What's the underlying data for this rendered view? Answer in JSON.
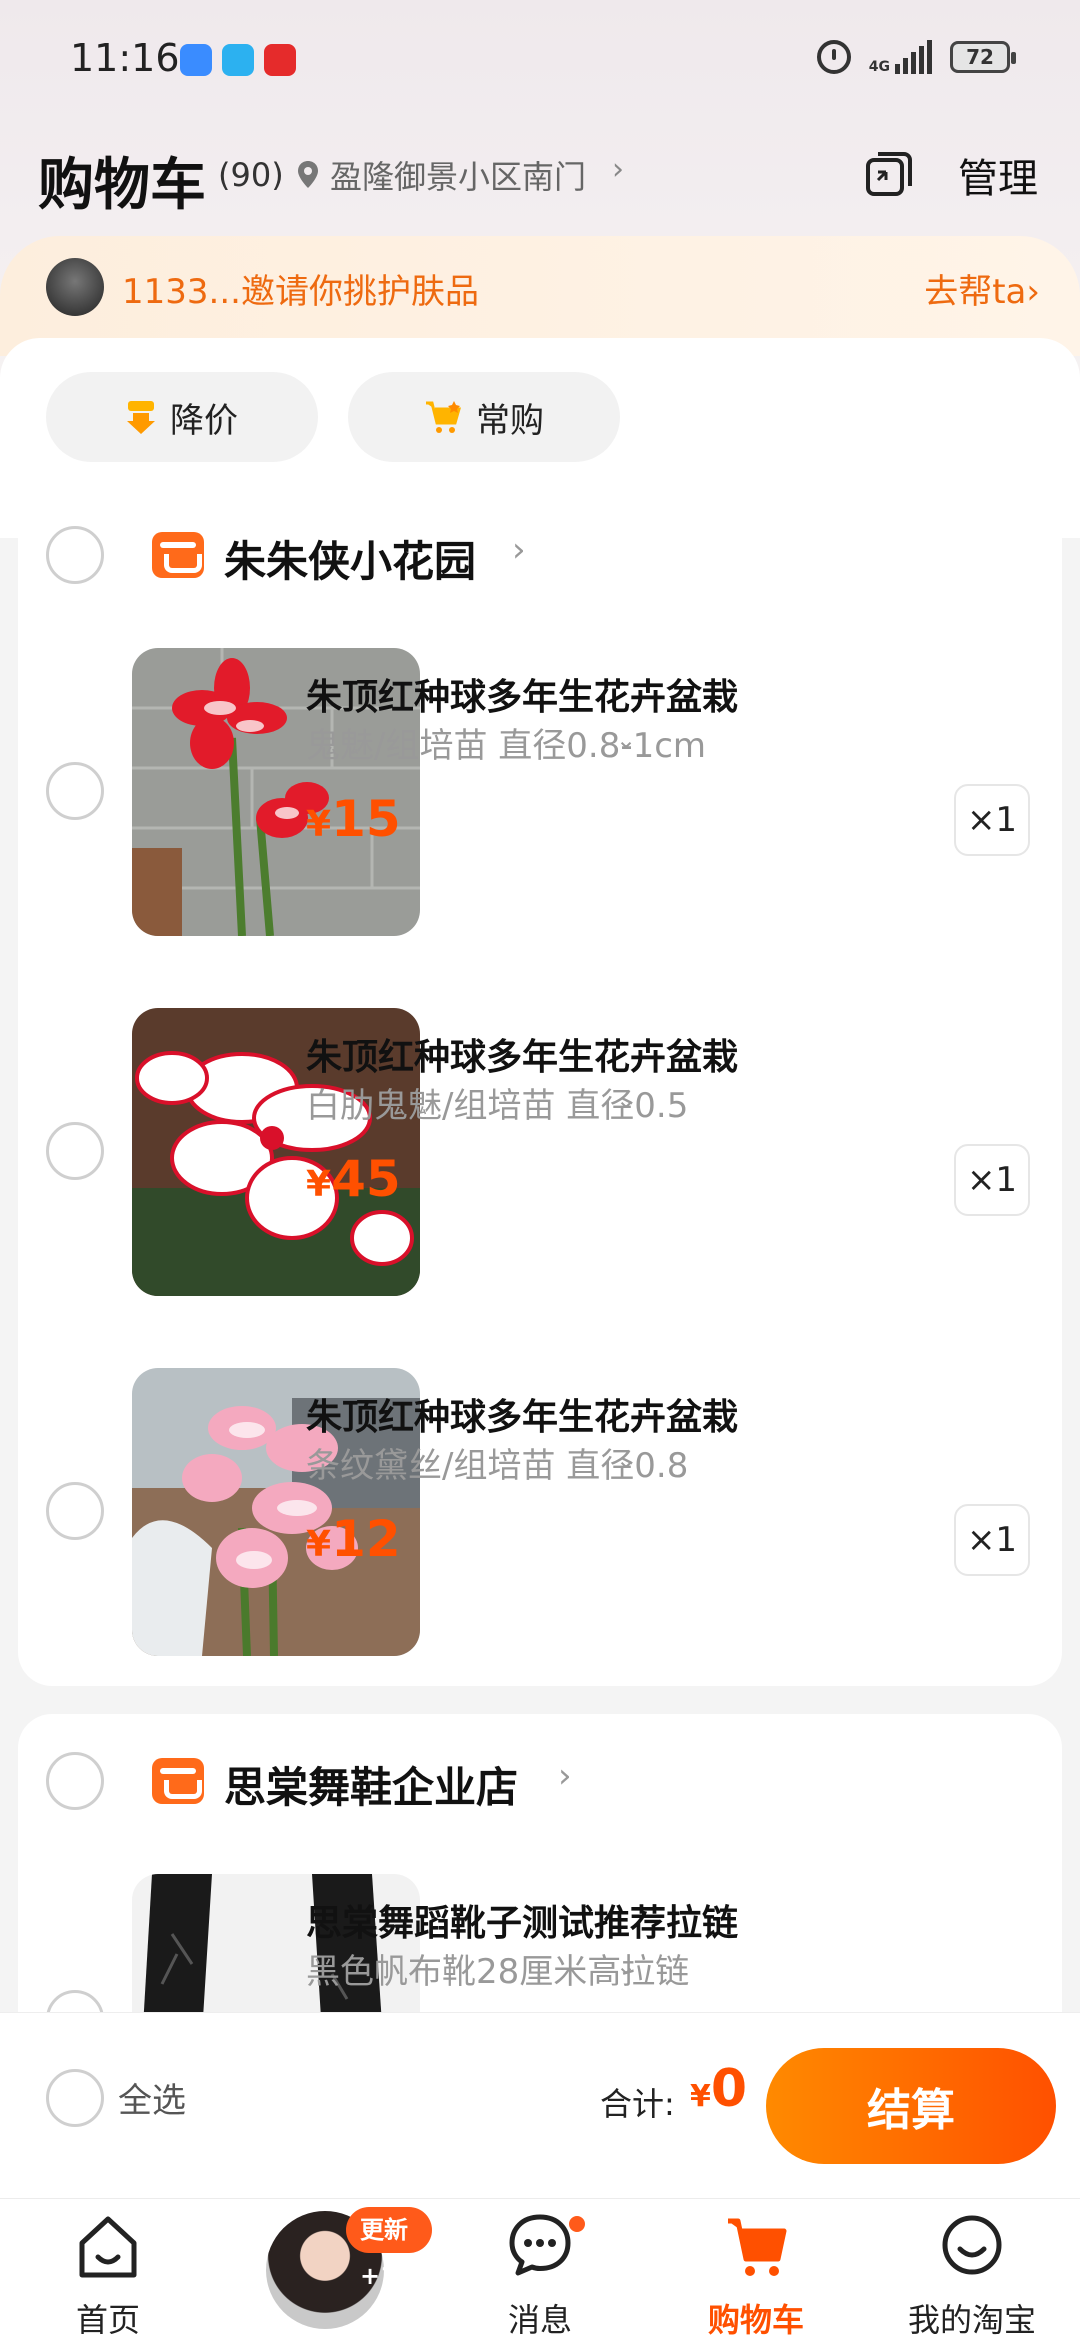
{
  "status_bar": {
    "time": "11:16",
    "network": "4G",
    "battery": "72"
  },
  "header": {
    "title": "购物车",
    "count": "(90)",
    "location": "盈隆御景小区南门",
    "manage_label": "管理"
  },
  "invite_banner": {
    "text": "1133...邀请你挑护肤品",
    "action": "去帮ta"
  },
  "filters": [
    {
      "label": "降价",
      "icon": "price-drop-icon"
    },
    {
      "label": "常购",
      "icon": "frequent-cart-icon"
    }
  ],
  "shops": [
    {
      "name": "朱朱侠小花园",
      "items": [
        {
          "title": "朱顶红种球多年生花卉盆栽",
          "spec": "鬼魅/组培苗 直径0.8-1cm",
          "currency": "¥",
          "price": "15",
          "qty": "×1"
        },
        {
          "title": "朱顶红种球多年生花卉盆栽",
          "spec": "白肋鬼魅/组培苗 直径0.5",
          "currency": "¥",
          "price": "45",
          "qty": "×1"
        },
        {
          "title": "朱顶红种球多年生花卉盆栽",
          "spec": "条纹黛丝/组培苗 直径0.8",
          "currency": "¥",
          "price": "12",
          "qty": "×1"
        }
      ]
    },
    {
      "name": "思棠舞鞋企业店",
      "items": [
        {
          "title": "思棠舞蹈靴子测试推荐拉链",
          "spec": "黑色帆布靴28厘米高拉链"
        }
      ]
    }
  ],
  "checkout": {
    "select_all": "全选",
    "total_label": "合计:",
    "currency": "¥",
    "total": "0",
    "button": "结算"
  },
  "tabs": [
    {
      "label": "首页"
    },
    {
      "badge": "更新+1"
    },
    {
      "label": "消息"
    },
    {
      "label": "购物车",
      "active": true
    },
    {
      "label": "我的淘宝"
    }
  ],
  "colors": {
    "accent": "#ff5000",
    "invite_text": "#ee6a10"
  }
}
